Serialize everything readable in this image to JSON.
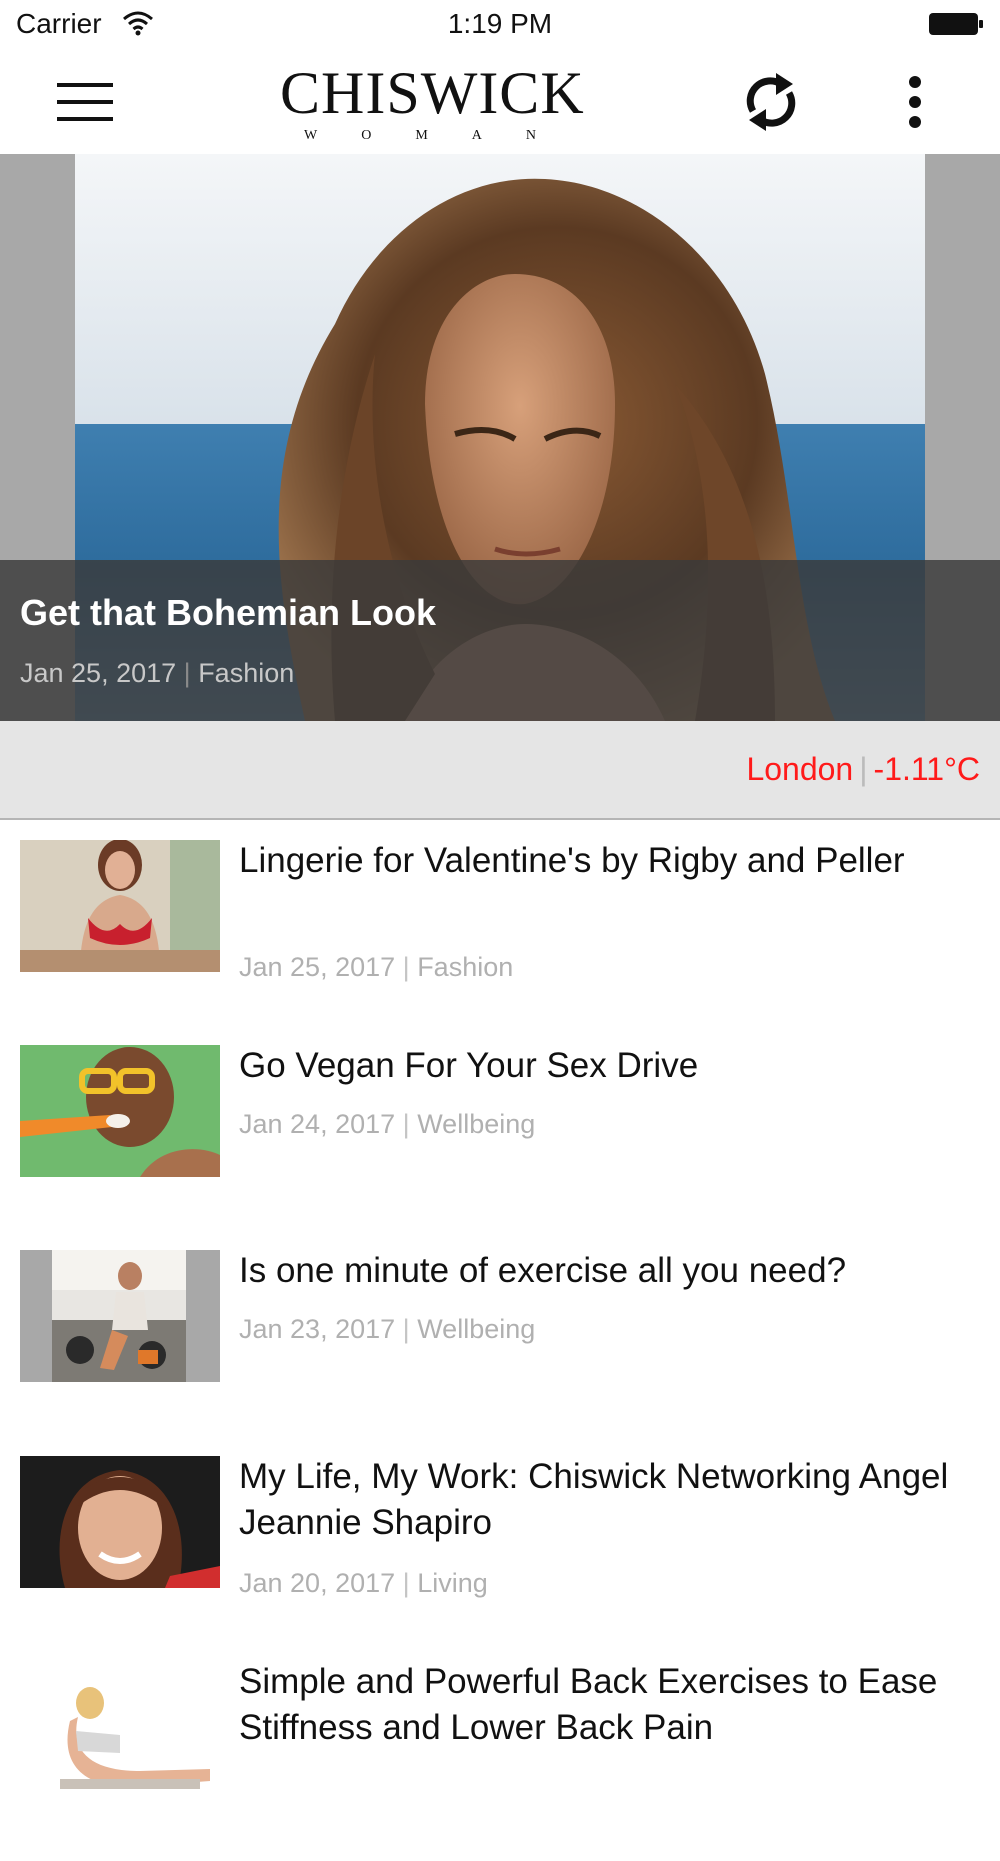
{
  "status_bar": {
    "carrier": "Carrier",
    "time": "1:19 PM"
  },
  "header": {
    "logo_main": "CHISWICK",
    "logo_sub": "WOMAN"
  },
  "hero": {
    "title": "Get that Bohemian Look",
    "date": "Jan 25, 2017",
    "separator": "|",
    "category": "Fashion"
  },
  "weather": {
    "city": "London",
    "separator": "|",
    "temperature": "-1.11°C",
    "color": "#ff1a1a"
  },
  "articles": [
    {
      "title": "Lingerie for Valentine's by Rigby and Peller",
      "date": "Jan 25, 2017",
      "separator": "|",
      "category": "Fashion"
    },
    {
      "title": "Go Vegan For Your Sex Drive",
      "date": "Jan 24, 2017",
      "separator": "|",
      "category": "Wellbeing"
    },
    {
      "title": "Is one minute of exercise all you need?",
      "date": "Jan 23, 2017",
      "separator": "|",
      "category": "Wellbeing"
    },
    {
      "title": "My Life, My Work: Chiswick Networking Angel Jeannie Shapiro",
      "date": "Jan 20, 2017",
      "separator": "|",
      "category": "Living"
    },
    {
      "title": "Simple and Powerful Back Exercises to Ease Stiffness and Lower Back Pain"
    }
  ]
}
